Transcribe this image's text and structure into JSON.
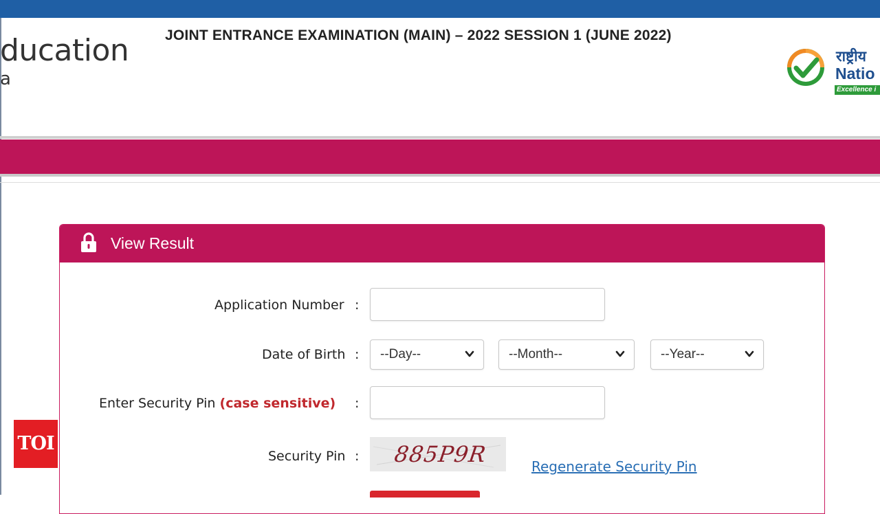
{
  "header": {
    "ministry_line1": "ducation",
    "ministry_line2": "a",
    "exam_title": "JOINT ENTRANCE EXAMINATION (MAIN) – 2022 SESSION 1 (JUNE 2022)",
    "logo": {
      "hindi": "राष्ट्रीय",
      "english": "Natio",
      "tagline": "Excellence i"
    }
  },
  "form": {
    "title": "View Result",
    "application_number": {
      "label": "Application Number",
      "value": ""
    },
    "dob": {
      "label": "Date of Birth",
      "day": "--Day--",
      "month": "--Month--",
      "year": "--Year--"
    },
    "security_pin_input": {
      "label": "Enter Security Pin",
      "note": "(case sensitive)",
      "value": ""
    },
    "security_pin": {
      "label": "Security Pin",
      "captcha": "885P9R"
    },
    "regenerate_link": "Regenerate Security Pin",
    "colon": ":"
  },
  "watermark": "TOI",
  "colors": {
    "topbar": "#1f5fa5",
    "accent": "#bd1558",
    "link": "#2a6fb5",
    "note": "#c0282d"
  },
  "icons": [
    "lock-icon",
    "chevron-down-icon",
    "nta-check-logo-icon"
  ]
}
